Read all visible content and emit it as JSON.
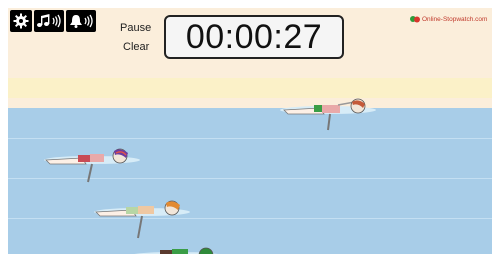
{
  "toolbar": {
    "icons": [
      "gear-icon",
      "music-volume-icon",
      "alarm-volume-icon"
    ]
  },
  "controls": {
    "pause_label": "Pause",
    "clear_label": "Clear"
  },
  "timer": {
    "display": "00:00:27"
  },
  "brand": {
    "text": "Online-Stopwatch.com"
  },
  "colors": {
    "background": "#fbeedb",
    "sand": "#fbf1c8",
    "water": "#a8cde8",
    "timer_border": "#222222",
    "brand_text": "#c0392b"
  }
}
